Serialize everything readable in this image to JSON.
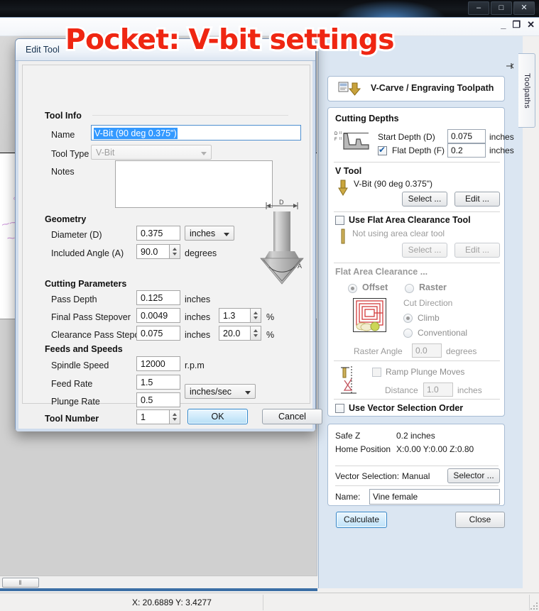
{
  "annotation": {
    "text": "Pocket: V-bit settings",
    "color": "#ef2612",
    "outline": "#ffffff"
  },
  "os_window": {
    "minimize": "–",
    "maximize": "□",
    "close": "✕"
  },
  "app_window": {
    "minimize": "_",
    "restore": "❐",
    "close": "✕"
  },
  "side_tab": {
    "label": "Toolpaths"
  },
  "status_bar": {
    "coordinates": "X: 20.6889 Y:  3.4277"
  },
  "canvas": {
    "hscroll_thumb": "‖"
  },
  "dialog": {
    "title": "Edit Tool",
    "sections": {
      "tool_info": "Tool Info",
      "geometry": "Geometry",
      "cutting_parameters": "Cutting Parameters",
      "feeds_and_speeds": "Feeds and Speeds"
    },
    "tool_info": {
      "name_label": "Name",
      "name_value": "V-Bit (90 deg 0.375\")",
      "tool_type_label": "Tool Type",
      "tool_type_value": "V-Bit",
      "notes_label": "Notes",
      "notes_value": ""
    },
    "geometry": {
      "diameter_label": "Diameter (D)",
      "diameter_value": "0.375",
      "diameter_units": "inches",
      "included_angle_label": "Included Angle (A)",
      "included_angle_value": "90.0",
      "included_angle_units": "degrees",
      "diagram_d": "D",
      "diagram_a": "A"
    },
    "cutting_parameters": {
      "pass_depth_label": "Pass Depth",
      "pass_depth_value": "0.125",
      "pass_depth_units": "inches",
      "final_pass_stepover_label": "Final Pass Stepover",
      "final_pass_stepover_value": "0.0049",
      "final_pass_stepover_units": "inches",
      "final_pass_stepover_pct": "1.3",
      "final_pass_pct_sym": "%",
      "clearance_pass_stepover_label": "Clearance Pass Stepover",
      "clearance_pass_stepover_value": "0.075",
      "clearance_pass_stepover_units": "inches",
      "clearance_pass_stepover_pct": "20.0",
      "clearance_pass_pct_sym": "%"
    },
    "feeds_and_speeds": {
      "spindle_speed_label": "Spindle Speed",
      "spindle_speed_value": "12000",
      "spindle_speed_units": "r.p.m",
      "feed_rate_label": "Feed Rate",
      "feed_rate_value": "1.5",
      "plunge_rate_label": "Plunge Rate",
      "plunge_rate_value": "0.5",
      "rate_units": "inches/sec"
    },
    "tool_number": {
      "label": "Tool Number",
      "value": "1"
    },
    "buttons": {
      "ok": "OK",
      "cancel": "Cancel"
    }
  },
  "toolpath_panel": {
    "header": "V-Carve / Engraving Toolpath",
    "cutting_depths": {
      "section": "Cutting Depths",
      "start_depth_label": "Start Depth (D)",
      "start_depth_value": "0.075",
      "start_depth_units": "inches",
      "flat_depth_label": "Flat Depth (F)",
      "flat_depth_checked": true,
      "flat_depth_value": "0.2",
      "flat_depth_units": "inches",
      "icon_d": "D",
      "icon_f": "F"
    },
    "v_tool": {
      "section": "V Tool",
      "tool_name": "V-Bit (90 deg 0.375\")",
      "select_button": "Select ...",
      "edit_button": "Edit ..."
    },
    "flat_area_tool": {
      "checkbox_label": "Use Flat Area Clearance Tool",
      "checked": false,
      "status_text": "Not using area clear tool",
      "select_button": "Select ...",
      "edit_button": "Edit ..."
    },
    "flat_area_clearance": {
      "section": "Flat Area Clearance ...",
      "offset_label": "Offset",
      "raster_label": "Raster",
      "strategy_selected": "Offset",
      "cut_direction_label": "Cut Direction",
      "climb_label": "Climb",
      "conventional_label": "Conventional",
      "cut_direction_selected": "Climb",
      "raster_angle_label": "Raster Angle",
      "raster_angle_value": "0.0",
      "raster_angle_units": "degrees"
    },
    "ramp": {
      "checkbox_label": "Ramp Plunge Moves",
      "checked": false,
      "distance_label": "Distance",
      "distance_value": "1.0",
      "distance_units": "inches"
    },
    "vector_selection_order": {
      "label": "Use Vector Selection Order",
      "checked": false
    },
    "footer": {
      "safe_z_label": "Safe Z",
      "safe_z_value": "0.2 inches",
      "home_position_label": "Home Position",
      "home_position_value": "X:0.00 Y:0.00 Z:0.80",
      "vector_selection_label": "Vector Selection:",
      "vector_selection_value": "Manual",
      "selector_button": "Selector ...",
      "name_label": "Name:",
      "name_value": "Vine female"
    },
    "actions": {
      "calculate": "Calculate",
      "close": "Close"
    }
  }
}
